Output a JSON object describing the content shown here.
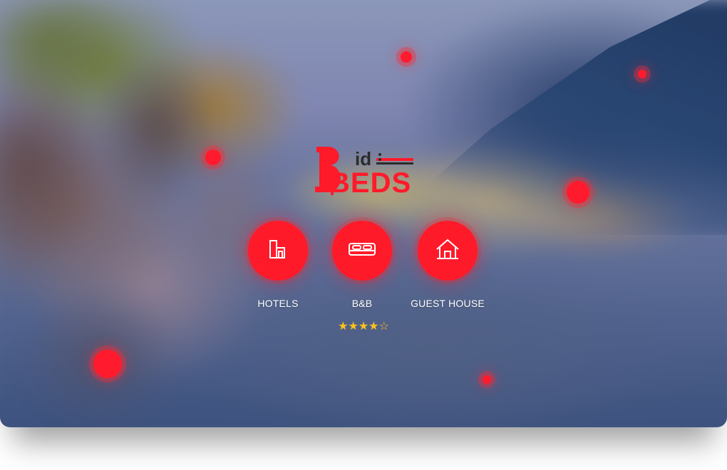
{
  "brand": {
    "logo_top": "id",
    "logo_main": "BEDS",
    "color": "#ff1a2a"
  },
  "categories": [
    {
      "label": "HOTELS",
      "icon": "hotel-building-icon"
    },
    {
      "label": "B&B",
      "icon": "bed-icon"
    },
    {
      "label": "GUEST HOUSE",
      "icon": "house-icon"
    }
  ],
  "rating": {
    "stars_display": "★★★★☆",
    "value": 4,
    "max": 5,
    "color": "#ffc21a"
  },
  "accent_color": "#ff1a2a"
}
